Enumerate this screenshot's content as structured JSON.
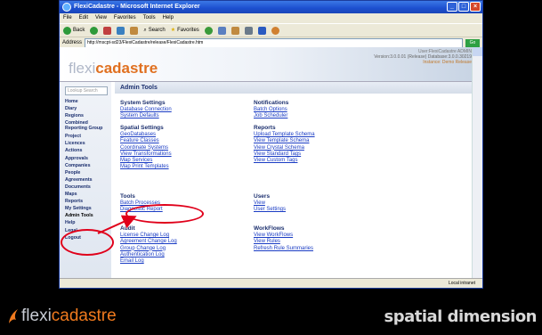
{
  "window": {
    "title": "FlexiCadastre - Microsoft Internet Explorer"
  },
  "menu": [
    "File",
    "Edit",
    "View",
    "Favorites",
    "Tools",
    "Help"
  ],
  "toolbar": {
    "back": "Back",
    "search": "Search",
    "favorites": "Favorites"
  },
  "address": {
    "label": "Address",
    "url": "http://mscpt-sd23/FlexiCadastre/release/FlexiCadastre.htm",
    "go": "Go"
  },
  "app": {
    "logo_prefix": "flexi",
    "logo_suffix": "cadastre",
    "user": "User:FlexiCadastre ADMIN",
    "version": "Version:3.0.0.01 (Release) Database:3.0.0.30219",
    "instance": "Instance: Demo Release"
  },
  "sidebar": {
    "search_placeholder": "Lookup Search",
    "items": [
      "Home",
      "Diary",
      "Regions",
      "Combined Reporting Group",
      "Project",
      "Licences",
      "Actions",
      "Approvals",
      "Companies",
      "People",
      "Agreements",
      "Documents",
      "Maps",
      "Reports",
      "My Settings",
      "Admin Tools",
      "Help",
      "Legal",
      "Logout"
    ]
  },
  "page_title": "Admin Tools",
  "sections": {
    "system": {
      "title": "System Settings",
      "links": [
        "Database Connection",
        "System Defaults"
      ]
    },
    "notifications": {
      "title": "Notifications",
      "links": [
        "Batch Options",
        "Job Scheduler"
      ]
    },
    "spatial": {
      "title": "Spatial Settings",
      "links": [
        "GeoDatabases",
        "Feature Classes",
        "Coordinate Systems",
        "View Transformations",
        "Map Services",
        "Map Print Templates"
      ]
    },
    "reports": {
      "title": "Reports",
      "links": [
        "Upload Template Schema",
        "View Template Schema",
        "View Crystal Schema",
        "View Standard Tags",
        "View Custom Tags"
      ]
    },
    "tools": {
      "title": "Tools",
      "links": [
        "Batch Processes",
        "Diagnostic Report"
      ]
    },
    "users": {
      "title": "Users",
      "links": [
        "View",
        "User Settings"
      ]
    },
    "audit": {
      "title": "Audit",
      "links": [
        "License Change Log",
        "Agreement Change Log",
        "Group Change Log",
        "Authentication Log",
        "Email Log"
      ]
    },
    "workflows": {
      "title": "WorkFlows",
      "links": [
        "View WorkFlows",
        "View Rules",
        "Refresh Rule Summaries"
      ]
    }
  },
  "status": {
    "zone": "Local intranet"
  },
  "footer": {
    "brand_prefix": "flexi",
    "brand_suffix": "cadastre",
    "partner": "spatial dimension"
  },
  "colors": {
    "accent": "#e07020",
    "link": "#1a3cc4",
    "nav": "#1b2f6e",
    "highlight": "#e0001a"
  }
}
